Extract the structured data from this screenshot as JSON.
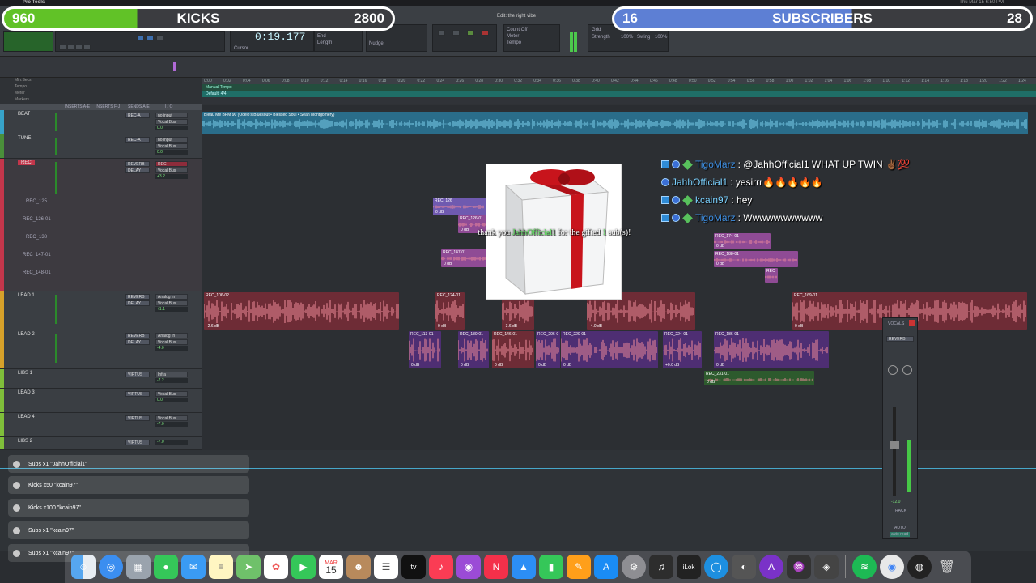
{
  "menubar": {
    "app": "Pro Tools",
    "items": [
      "File",
      "Edit",
      "View",
      "Track",
      "Clip",
      "Event",
      "AudioSuite",
      "Options",
      "Setup",
      "Window",
      "Help"
    ],
    "clock": "Thu Mar 15  6:50 PM"
  },
  "edit_window_title": "Edit: the right vibe",
  "kicks_bar": {
    "count": "960",
    "title": "KICKS",
    "goal": "2800",
    "progress": 0.343,
    "color": "#61c227"
  },
  "subs_bar": {
    "count": "16",
    "title": "SUBSCRIBERS",
    "goal": "28",
    "progress": 0.571,
    "color": "#5d7fd4"
  },
  "transport": {
    "main_counter": "0:19.177",
    "start_label": "Start",
    "end_label": "End",
    "length_label": "Length",
    "cursor_label": "Cursor",
    "nudge_label": "Nudge",
    "grid_label": "Grid",
    "meter_label": "Meter",
    "tempo_label": "Tempo",
    "count_off_label": "Count Off",
    "strength_label": "Strength",
    "swing_label": "Swing",
    "strength_value": "100%",
    "swing_value": "100%"
  },
  "rulers": {
    "min_secs": "Min:Secs",
    "tempo": "Tempo",
    "meter": "Meter",
    "markers": "Markers",
    "manual_tempo": "Manual Tempo",
    "default_meter": "Default: 4/4",
    "ticks": [
      "0:00",
      "0:02",
      "0:04",
      "0:06",
      "0:08",
      "0:10",
      "0:12",
      "0:14",
      "0:16",
      "0:18",
      "0:20",
      "0:22",
      "0:24",
      "0:26",
      "0:28",
      "0:30",
      "0:32",
      "0:34",
      "0:36",
      "0:38",
      "0:40",
      "0:42",
      "0:44",
      "0:46",
      "0:48",
      "0:50",
      "0:52",
      "0:54",
      "0:56",
      "0:58",
      "1:00",
      "1:02",
      "1:04",
      "1:06",
      "1:08",
      "1:10",
      "1:12",
      "1:14",
      "1:16",
      "1:18",
      "1:20",
      "1:22",
      "1:24"
    ]
  },
  "track_columns": {
    "inserts_a": "INSERTS A-E",
    "inserts_f": "INSERTS F-J",
    "sends": "SENDS A-E",
    "io": "I / O"
  },
  "tracks": [
    {
      "name": "BEAT",
      "color": "#37a3c9",
      "insert": "REC-A",
      "insert2": "",
      "io_in": "no input",
      "io_out": "Vocal Bus",
      "vol": "0.0",
      "pan": "0"
    },
    {
      "name": "TUNE",
      "color": "#4a8f3a",
      "insert": "REC-A",
      "insert2": "",
      "io_in": "no input",
      "io_out": "Vocal Bus",
      "vol": "0.0",
      "pan": "0"
    },
    {
      "name": "REC",
      "color": "#c3364b",
      "insert": "REVERB",
      "insert2": "DELAY",
      "io_in": "REC",
      "io_out": "Vocal Bus",
      "vol": "+3.2",
      "pan": "0"
    },
    {
      "name": "LEAD 1",
      "color": "#d6a12a",
      "insert": "REVERB",
      "insert2": "DELAY",
      "io_in": "Analog In",
      "io_out": "Vocal Bus",
      "vol": "+1.1",
      "pan": "0"
    },
    {
      "name": "LEAD 2",
      "color": "#d6a12a",
      "insert": "REVERB",
      "insert2": "DELAY",
      "io_in": "Analog In",
      "io_out": "Vocal Bus",
      "vol": "-4.0",
      "pan": "0"
    },
    {
      "name": "LIBS 1",
      "color": "#7fbe3a",
      "insert": "VIRTUS",
      "insert2": "",
      "io_in": "Infra",
      "io_out": "Vocal Bus",
      "vol": "-7.2",
      "pan": "0"
    },
    {
      "name": "LEAD 3",
      "color": "#7fbe3a",
      "insert": "VIRTUS",
      "insert2": "",
      "io_in": "",
      "io_out": "Vocal Bus",
      "vol": "0.0",
      "pan": "0"
    },
    {
      "name": "LEAD 4",
      "color": "#7fbe3a",
      "insert": "VIRTUS",
      "insert2": "",
      "io_in": "",
      "io_out": "Vocal Bus",
      "vol": "-7.0",
      "pan": "0"
    },
    {
      "name": "LIBS 2",
      "color": "#7fbe3a",
      "insert": "VIRTUS",
      "insert2": "",
      "io_in": "",
      "io_out": "Vocal Bus",
      "vol": "-7.0",
      "pan": "0"
    }
  ],
  "rec_playlists": [
    "REC_125",
    "REC_126-01",
    "REC_138",
    "REC_147-01",
    "REC_148-01"
  ],
  "beat_clip_name": "Bleau Me BPM 90 (Ocelo's Bluesout • Blessed Soul • Sean Montgomery)",
  "clips": {
    "rec": [
      {
        "name": "REC_126",
        "db": "0 dB"
      },
      {
        "name": "REC_126-01",
        "db": "0 dB"
      },
      {
        "name": "REC_147-01",
        "db": "0 dB"
      },
      {
        "name": "REC_174-01",
        "db": "0 dB"
      },
      {
        "name": "REC_188-01",
        "db": "0 dB"
      },
      {
        "name": "REC",
        "db": ""
      }
    ],
    "lead1": [
      {
        "name": "REC_106-02",
        "db": "-2.6 dB"
      },
      {
        "name": "REC_124-01",
        "db": "0 dB"
      },
      {
        "name": "",
        "db": "-3.6 dB"
      },
      {
        "name": "",
        "db": "-4.0 dB"
      },
      {
        "name": "REC_169-01",
        "db": "0 dB"
      }
    ],
    "lead2": [
      {
        "name": "REC_113-01",
        "db": "0 dB"
      },
      {
        "name": "REC_130-01",
        "db": "0 dB"
      },
      {
        "name": "REC_146-01",
        "db": "0 dB"
      },
      {
        "name": "REC_206-0",
        "db": "0 dB"
      },
      {
        "name": "REC_220-01",
        "db": "0 dB"
      },
      {
        "name": "REC_224-01",
        "db": "+0.0 dB"
      },
      {
        "name": "REC_186-01",
        "db": "0 dB"
      }
    ],
    "libs1": [
      {
        "name": "REC_231-01",
        "db": "0 dB"
      }
    ]
  },
  "chat": [
    {
      "user": "TigoMarz",
      "user_color": "#3d8de0",
      "message": ": @JahhOfficial1 WHAT UP TWIN ✌🏾💯"
    },
    {
      "user": "JahhOfficial1",
      "user_color": "#7ad1ff",
      "message": ": yesirrr🔥🔥🔥🔥🔥"
    },
    {
      "user": "kcain97",
      "user_color": "#7ad1ff",
      "message": ": hey"
    },
    {
      "user": "TigoMarz",
      "user_color": "#3d8de0",
      "message": ": Wwwwwwwwwww"
    }
  ],
  "gift_alert": {
    "prefix": "thank you ",
    "user": "JahhOfficial1",
    "middle": " for the gifted ",
    "count": "1",
    "suffix": " sub(s)!"
  },
  "notifications": [
    {
      "text": "Subs x1 \"JahhOfficial1\""
    },
    {
      "text": "Kicks x50 \"kcain97\""
    },
    {
      "text": "Kicks x100 \"kcain97\""
    },
    {
      "text": "Subs x1 \"kcain97\""
    },
    {
      "text": "Subs x1 \"kcain97\""
    }
  ],
  "mixer": {
    "name": "VOCALS",
    "insert": "REVERB",
    "value": "-12.0",
    "track_label": "TRACK",
    "auto_label": "AUTO",
    "mode": "auto read"
  },
  "dock": {
    "calendar_month": "MAR",
    "calendar_day": "15",
    "icons": [
      "finder-icon",
      "safari-icon",
      "launchpad-icon",
      "messages-icon",
      "mail-icon",
      "notes-icon",
      "maps-icon",
      "photos-icon",
      "facetime-icon",
      "calendar-icon",
      "contacts-icon",
      "reminders-icon",
      "appletv-icon",
      "music-icon",
      "podcasts-icon",
      "news-icon",
      "keynote-icon",
      "numbers-icon",
      "pages-icon",
      "appstore-icon",
      "settings-icon",
      "logic-icon",
      "ilok-icon",
      "circle-app-icon",
      "disk-utility-icon",
      "avid-icon",
      "mixer-icon",
      "studio-icon",
      "spotify-icon",
      "chrome-icon",
      "obs-icon",
      "trash-icon"
    ]
  }
}
